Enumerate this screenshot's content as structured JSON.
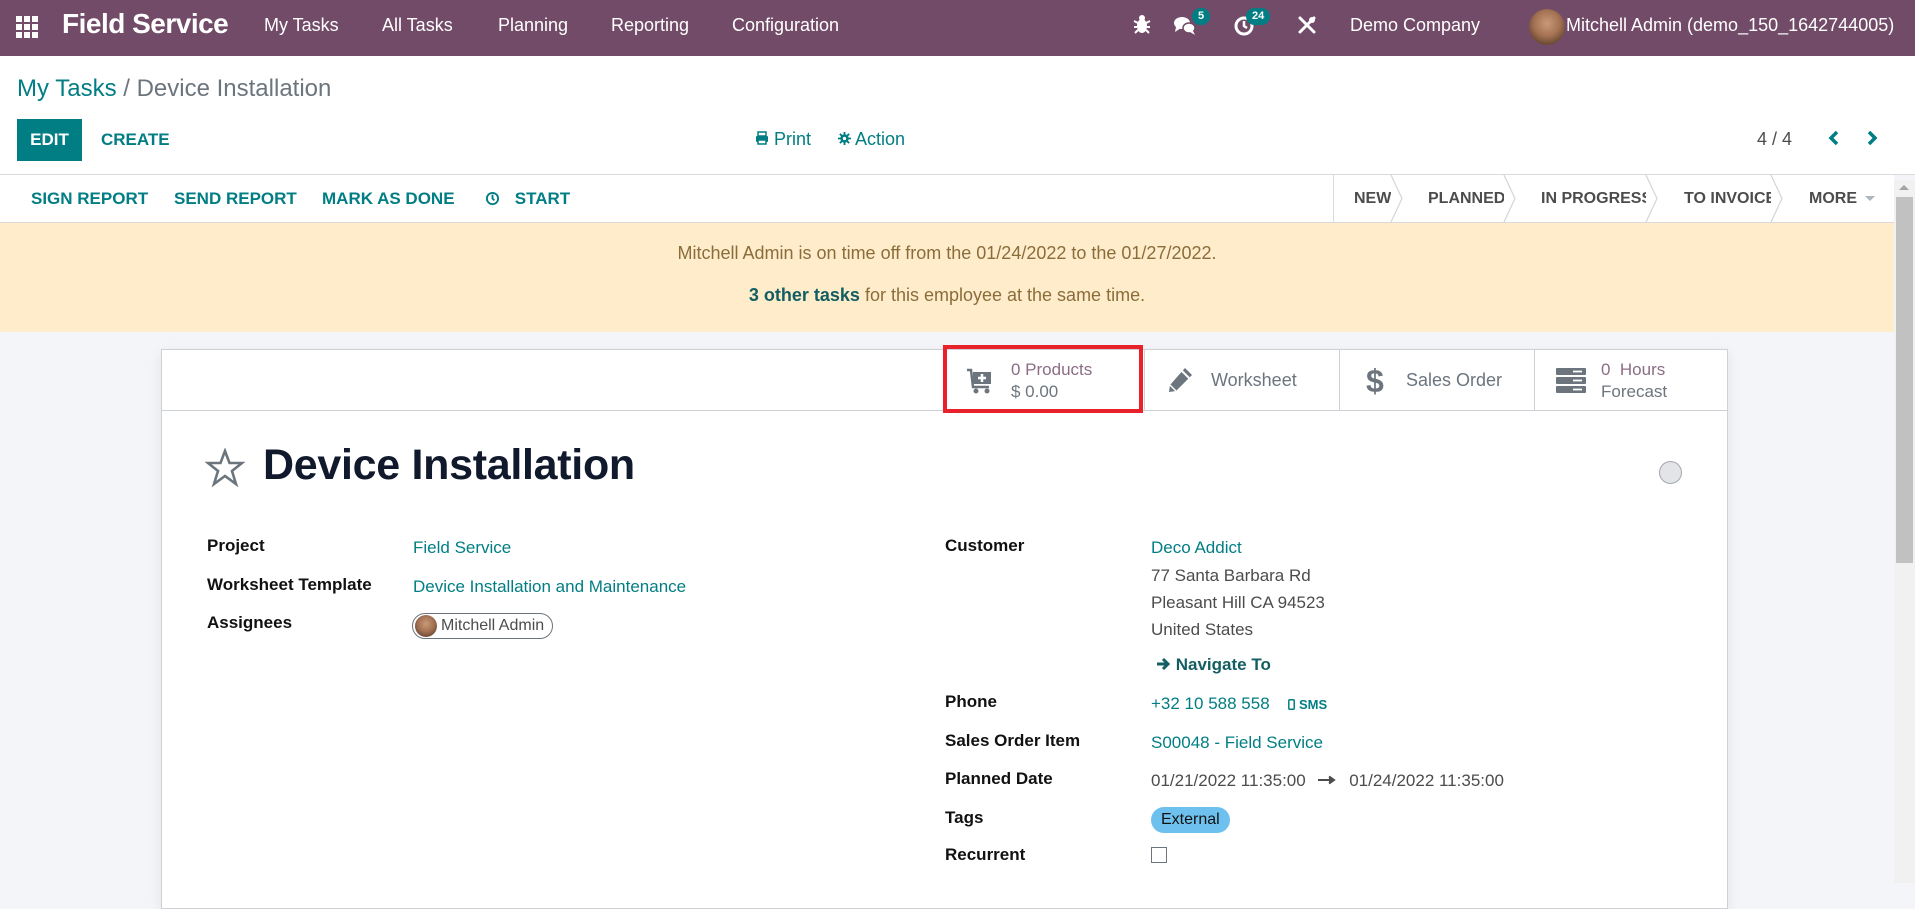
{
  "navbar": {
    "app_name": "Field Service",
    "menus": [
      "My Tasks",
      "All Tasks",
      "Planning",
      "Reporting",
      "Configuration"
    ],
    "messages_count": "5",
    "activities_count": "24",
    "company": "Demo Company",
    "user": "Mitchell Admin (demo_150_1642744005)"
  },
  "control_panel": {
    "breadcrumb_parent": "My Tasks",
    "breadcrumb_separator": "/",
    "breadcrumb_current": "Device Installation",
    "edit_label": "EDIT",
    "create_label": "CREATE",
    "print_label": "Print",
    "action_label": "Action",
    "pager": "4 / 4"
  },
  "statusbar": {
    "buttons": [
      "SIGN REPORT",
      "SEND REPORT",
      "MARK AS DONE",
      "START"
    ],
    "stages": [
      "NEW",
      "PLANNED",
      "IN PROGRESS",
      "TO INVOICE",
      "MORE"
    ]
  },
  "alert": {
    "line1": "Mitchell Admin is on time off from the 01/24/2022 to the 01/27/2022.",
    "link": "3 other tasks",
    "line2_rest": " for this employee at the same time."
  },
  "smart_buttons": {
    "products": {
      "value": "0 Products",
      "amount": "$ 0.00",
      "highlighted": true
    },
    "worksheet": {
      "label": "Worksheet"
    },
    "sales_order": {
      "label": "Sales Order"
    },
    "hours": {
      "value": "0  Hours",
      "label": "Forecast"
    }
  },
  "record": {
    "title": "Device Installation",
    "left_fields": {
      "project_label": "Project",
      "project_value": "Field Service",
      "worksheet_label": "Worksheet Template",
      "worksheet_value": "Device Installation and Maintenance",
      "assignees_label": "Assignees",
      "assignees_value": "Mitchell Admin"
    },
    "right_fields": {
      "customer_label": "Customer",
      "customer_name": "Deco Addict",
      "address_line1": "77 Santa Barbara Rd",
      "address_line2": "Pleasant Hill CA 94523",
      "address_line3": "United States",
      "navigate_label": "Navigate To",
      "phone_label": "Phone",
      "phone_value": "+32 10 588 558",
      "sms_label": "SMS",
      "so_item_label": "Sales Order Item",
      "so_item_value": "S00048 - Field Service",
      "planned_label": "Planned Date",
      "planned_start": "01/21/2022 11:35:00",
      "planned_end": "01/24/2022 11:35:00",
      "tags_label": "Tags",
      "tag_value": "External",
      "recurrent_label": "Recurrent",
      "recurrent_checked": false
    }
  },
  "colors": {
    "brand": "#714b67",
    "accent": "#017e84",
    "alert_bg": "#ffeccb",
    "highlight": "#e8212a",
    "tag": "#6ec1ee"
  }
}
